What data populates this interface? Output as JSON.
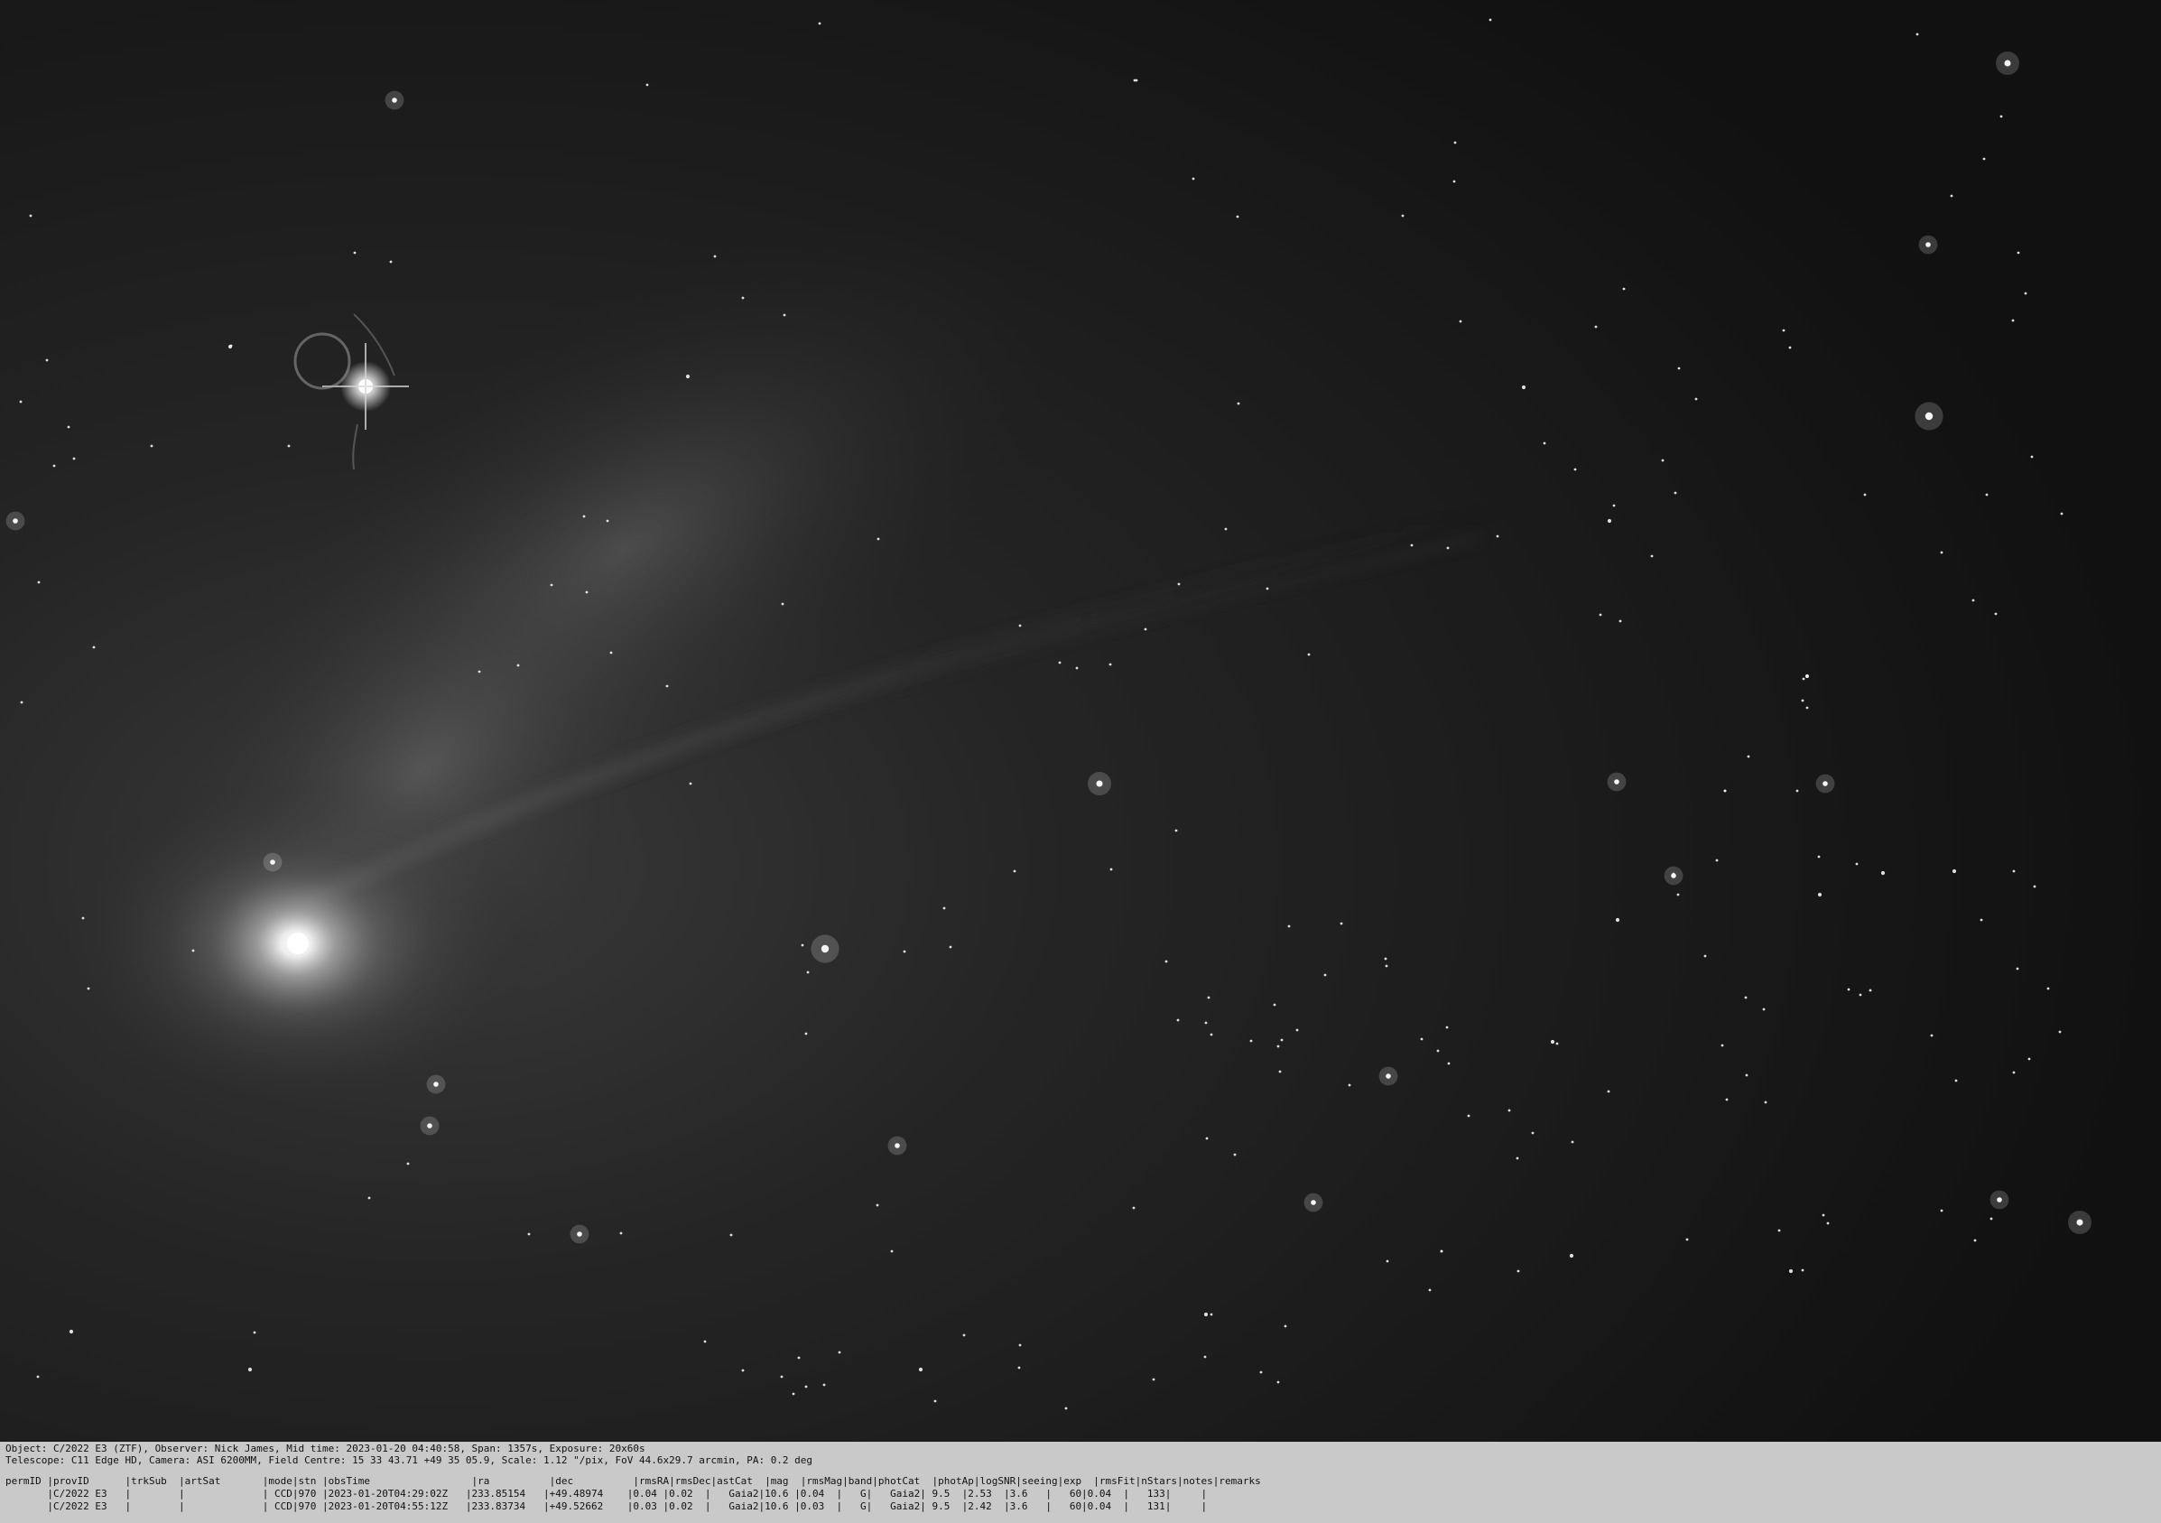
{
  "image": {
    "subject": "Comet C/2022 E3 (ZTF) in star field",
    "colors": {
      "sky": "#121212",
      "coma_core": "#ffffff",
      "caption_bg": "#c9c9c9",
      "caption_text": "#111111"
    }
  },
  "caption": {
    "object_line": "Object: C/2022 E3 (ZTF), Observer: Nick James, Mid time: 2023-01-20 04:40:58, Span: 1357s, Exposure: 20x60s",
    "telescope_line": "Telescope: C11 Edge HD, Camera: ASI 6200MM, Field Centre: 15 33 43.71 +49 35 05.9, Scale: 1.12 \"/pix, FoV 44.6x29.7 arcmin, PA: 0.2 deg"
  },
  "astrometry": {
    "header": "permID |provID      |trkSub  |artSat       |mode|stn |obsTime                 |ra          |dec          |rmsRA|rmsDec|astCat  |mag  |rmsMag|band|photCat  |photAp|logSNR|seeing|exp  |rmsFit|nStars|notes|remarks",
    "rows": [
      "       |C/2022 E3   |        |             | CCD|970 |2023-01-20T04:29:02Z   |233.85154   |+49.48974    |0.04 |0.02  |   Gaia2|10.6 |0.04  |   G|   Gaia2| 9.5  |2.53  |3.6   |   60|0.04  |   133|     |",
      "       |C/2022 E3   |        |             | CCD|970 |2023-01-20T04:55:12Z   |233.83734   |+49.52662    |0.03 |0.02  |   Gaia2|10.6 |0.03  |   G|   Gaia2| 9.5  |2.42  |3.6   |   60|0.04  |   131|     |"
    ]
  }
}
